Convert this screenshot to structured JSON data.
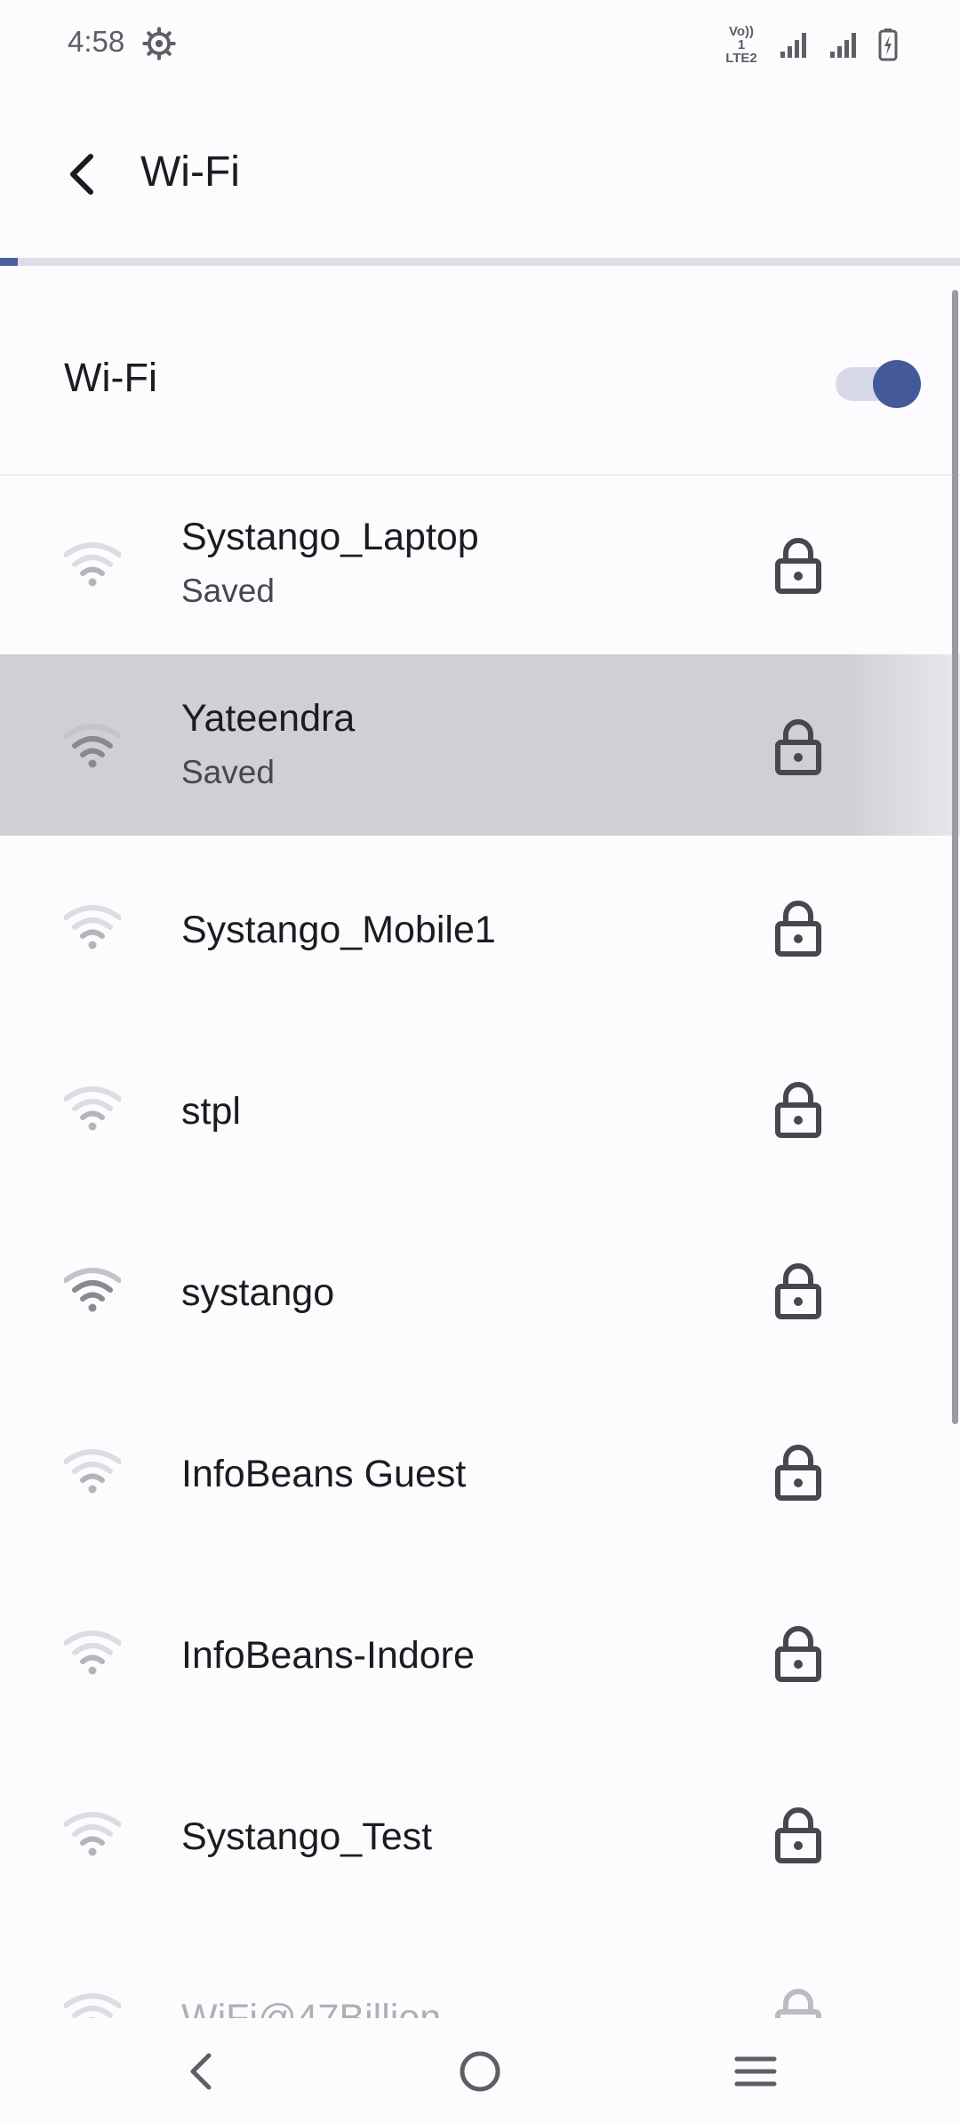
{
  "status_bar": {
    "time": "4:58",
    "volte_line1": "Vo)) 1",
    "volte_line2": "LTE2"
  },
  "app_bar": {
    "title": "Wi-Fi"
  },
  "wifi_toggle": {
    "label": "Wi-Fi",
    "enabled": true
  },
  "networks": [
    {
      "name": "Systango_Laptop",
      "status": "Saved"
    },
    {
      "name": "Yateendra",
      "status": "Saved"
    },
    {
      "name": "Systango_Mobile1",
      "status": ""
    },
    {
      "name": "stpl",
      "status": ""
    },
    {
      "name": "systango",
      "status": ""
    },
    {
      "name": "InfoBeans Guest",
      "status": ""
    },
    {
      "name": "InfoBeans-Indore",
      "status": ""
    },
    {
      "name": "Systango_Test",
      "status": ""
    },
    {
      "name": "WiFi@47Billion",
      "status": ""
    }
  ],
  "colors": {
    "accent": "#43599a",
    "background": "#fdfbfe",
    "highlight_row": "#d0cfd3"
  }
}
